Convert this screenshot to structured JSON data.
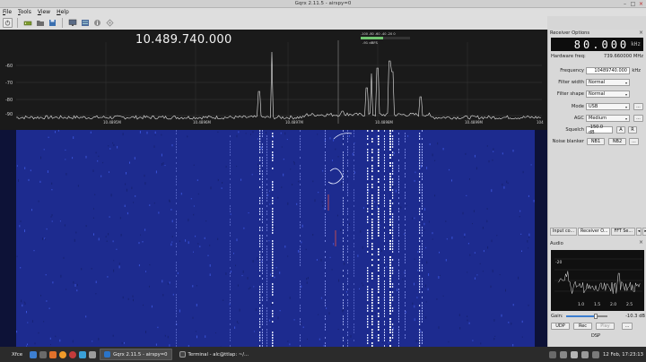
{
  "window": {
    "title": "Gqrx 2.11.5 - airspy=0",
    "controls": [
      "–",
      "□",
      "×"
    ]
  },
  "menu": [
    "File",
    "Tools",
    "View",
    "Help"
  ],
  "toolbar": {
    "icons": [
      "power-icon",
      "device-icon",
      "folder-icon",
      "save-icon",
      "screen-icon",
      "settings-icon",
      "info-icon",
      "network-icon"
    ]
  },
  "spectrum": {
    "frequency": "10.489.740.000",
    "y_labels": [
      "-60",
      "-70",
      "-80",
      "-90"
    ],
    "x_labels": [
      "10.4895M",
      "10.4896M",
      "10.4897M",
      "10.4898M",
      "10.4899M",
      "104"
    ],
    "meter_scale": "-100  -80  -60  -40  -20  0",
    "meter_readout": "-91 dBFS",
    "meter_level": 0.45
  },
  "receiver": {
    "dock_title": "Receiver Options",
    "lcd_value": "80.000",
    "lcd_unit": "kHz",
    "hardware_label": "Hardware freq:",
    "hardware_value": "739.660000 MHz",
    "frequency_label": "Frequency",
    "frequency_value": "10489740.000",
    "frequency_unit": "kHz",
    "filter_width_label": "Filter width",
    "filter_width_value": "Normal",
    "filter_shape_label": "Filter shape",
    "filter_shape_value": "Normal",
    "mode_label": "Mode",
    "mode_value": "USB",
    "agc_label": "AGC",
    "agc_value": "Medium",
    "squelch_label": "Squelch",
    "squelch_value": "-150.0 dB",
    "squelch_a": "A",
    "squelch_r": "R",
    "nb_label": "Noise blanker",
    "nb1": "NB1",
    "nb2": "NB2",
    "more": "..."
  },
  "tabs": [
    "Input co...",
    "Receiver O...",
    "FFT Se..."
  ],
  "audio": {
    "title": "Audio",
    "y_label": "-20",
    "x_labels": [
      "1.0",
      "1.5",
      "2.0",
      "2.5"
    ],
    "gain_label": "Gain:",
    "gain_value": "-10.3 dB",
    "gain_level": 0.72,
    "udp": "UDP",
    "rec": "Rec",
    "play": "Play",
    "more": "...",
    "dsp": "DSP"
  },
  "taskbar": {
    "start": "Xfce",
    "tasks": [
      "Gqrx 2.11.5 - airspy=0",
      "Terminal - alc@ttlap: ~/..."
    ],
    "clock": "12 Feb, 17:23:13"
  },
  "colors": {
    "waterfall_bg": "#1d2b8f",
    "spectrum_bg": "#1a1a1a",
    "trace": "#e9e9e9"
  }
}
